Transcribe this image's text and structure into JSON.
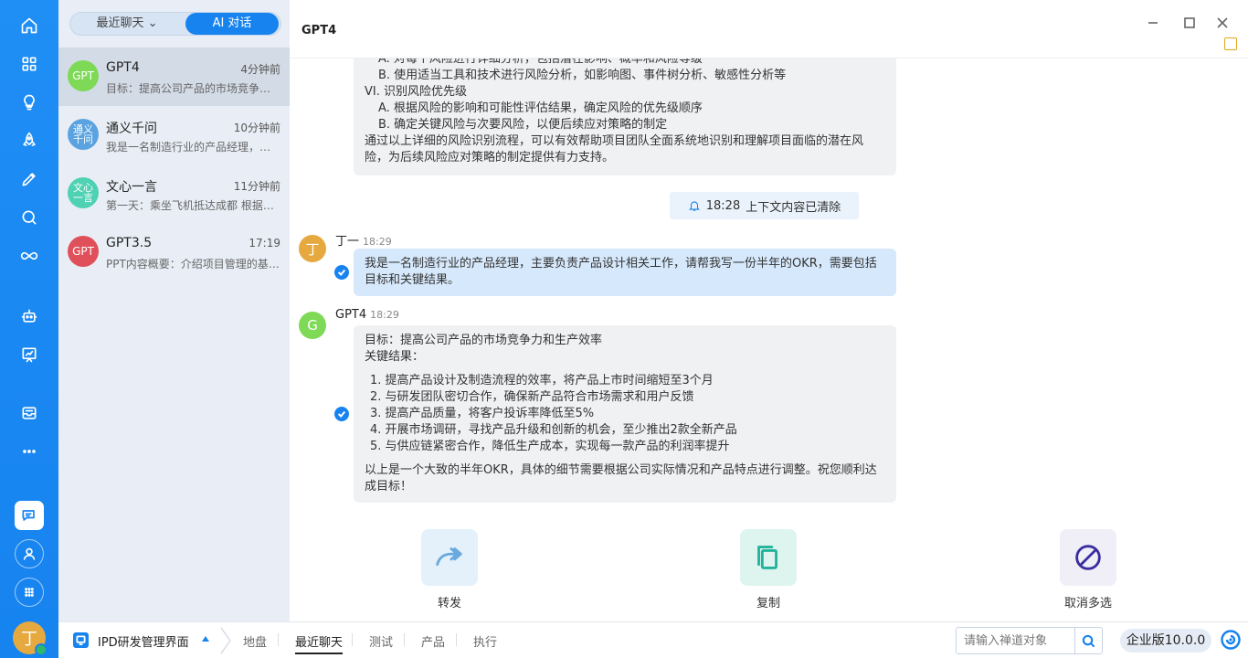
{
  "rail": {
    "icons": [
      "home-icon",
      "apps-grid-icon",
      "lightbulb-icon",
      "rocket-icon",
      "pen-icon",
      "search-icon",
      "infinity-icon",
      "robot-icon",
      "chart-board-icon",
      "inbox-icon",
      "more-dots-icon",
      "chat-icon",
      "user-icon",
      "apps-small-icon"
    ],
    "me_avatar": "丁"
  },
  "sidebar": {
    "segment": {
      "recent": "最近聊天",
      "ai": "AI 对话"
    },
    "chats": [
      {
        "avatar": "GPT",
        "avatar_color": "#7ed957",
        "name": "GPT4",
        "time": "4分钟前",
        "preview": "目标：提高公司产品的市场竞争力和生产效率"
      },
      {
        "avatar": "通义千问",
        "avatar_color": "#5aa3e0",
        "name": "通义千问",
        "time": "10分钟前",
        "preview": "我是一名制造行业的产品经理，主要负责产品设计"
      },
      {
        "avatar": "文心一言",
        "avatar_color": "#4fd1b4",
        "name": "文心一言",
        "time": "11分钟前",
        "preview": "第一天：乘坐飞机抵达成都 根据您的要求安排"
      },
      {
        "avatar": "GPT",
        "avatar_color": "#e0505a",
        "name": "GPT3.5",
        "time": "17:19",
        "preview": "PPT内容概要：介绍项目管理的基本概念"
      }
    ]
  },
  "header": {
    "title": "GPT4"
  },
  "messages": {
    "prev_lines": [
      {
        "text": "A. 对每个风险进行详细分析，包括潜在影响、概率和风险等级",
        "indent": true
      },
      {
        "text": "B. 使用适当工具和技术进行风险分析，如影响图、事件树分析、敏感性分析等",
        "indent": true
      },
      {
        "text": "VI. 识别风险优先级",
        "indent": false
      },
      {
        "text": "A. 根据风险的影响和可能性评估结果，确定风险的优先级顺序",
        "indent": true
      },
      {
        "text": "B. 确定关键风险与次要风险，以便后续应对策略的制定",
        "indent": true
      },
      {
        "text": "通过以上详细的风险识别流程，可以有效帮助项目团队全面系统地识别和理解项目面临的潜在风",
        "indent": false
      },
      {
        "text": "险，为后续风险应对策略的制定提供有力支持。",
        "indent": false
      }
    ],
    "system_notice": {
      "time": "18:28",
      "text": "上下文内容已清除"
    },
    "user": {
      "avatar": "丁",
      "name": "丁一",
      "time": "18:29",
      "lines": [
        "我是一名制造行业的产品经理，主要负责产品设计相关工作，请帮我写一份半年的OKR，需要包括",
        "目标和关键结果。"
      ]
    },
    "bot": {
      "avatar": "G",
      "name": "GPT4",
      "time": "18:29",
      "goal": "目标：提高公司产品的市场竞争力和生产效率",
      "kr_title": "关键结果：",
      "items": [
        "1. 提高产品设计及制造流程的效率，将产品上市时间缩短至3个月",
        "2. 与研发团队密切合作，确保新产品符合市场需求和用户反馈",
        "3. 提高产品质量，将客户投诉率降低至5%",
        "4. 开展市场调研，寻找产品升级和创新的机会，至少推出2款全新产品",
        "5. 与供应链紧密合作，降低生产成本，实现每一款产品的利润率提升"
      ],
      "closing": [
        "以上是一个大致的半年OKR，具体的细节需要根据公司实际情况和产品特点进行调整。祝您顺利达",
        "成目标！"
      ]
    }
  },
  "actions": {
    "forward": "转发",
    "copy": "复制",
    "cancel": "取消多选"
  },
  "bottom": {
    "project": "IPD研发管理界面",
    "tabs": [
      "地盘",
      "最近聊天",
      "测试",
      "产品",
      "执行"
    ],
    "active_tab": 1,
    "search_placeholder": "请输入禅道对象",
    "version": "企业版10.0.0"
  },
  "colors": {
    "accent": "#1683ef",
    "user_bubble": "#d6e8fb",
    "bot_bubble": "#f0f1f3"
  }
}
